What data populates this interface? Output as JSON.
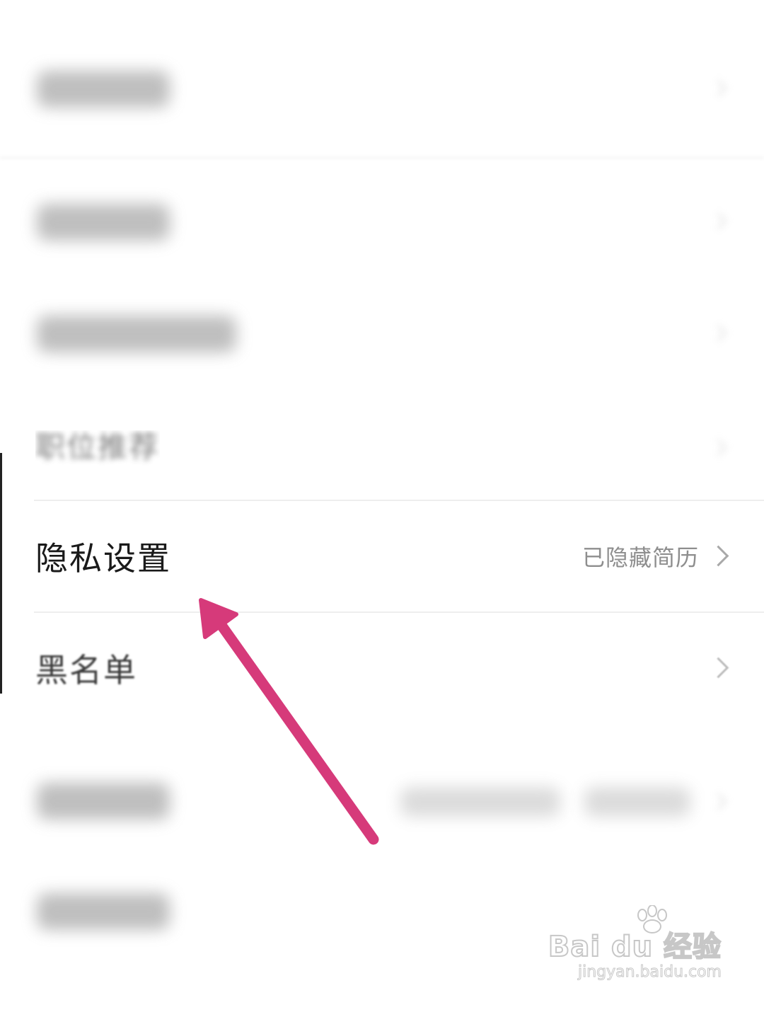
{
  "settings_list": {
    "partial_item_label": "职位推荐",
    "privacy_row": {
      "label": "隐私设置",
      "value": "已隐藏简历"
    },
    "blacklist_row": {
      "label": "黑名单"
    }
  },
  "annotation": {
    "arrow_color": "#d63a7a",
    "arrow_target": "privacy-settings-row"
  },
  "watermark": {
    "logo_text": "Bai du 经验",
    "url": "jingyan.baidu.com"
  },
  "icons": {
    "row_chevron": "chevron-right-icon"
  }
}
